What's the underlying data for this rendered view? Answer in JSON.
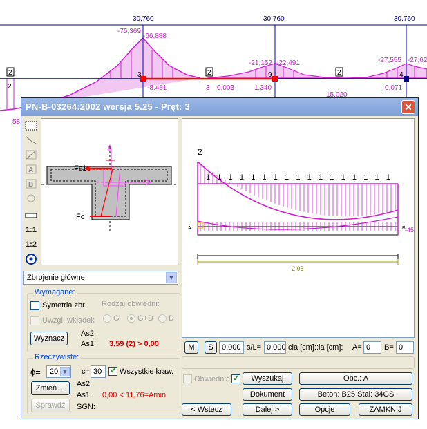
{
  "background": {
    "top_values": [
      "30,760",
      "30,760",
      "30,760"
    ],
    "moment_labels": [
      "-75,369",
      "-66,888",
      "-21,152",
      "-22,491",
      "-27,555",
      "-27,62"
    ],
    "axis_labels": [
      "-8,481",
      "3",
      "0,003",
      "1,340",
      "0,071",
      "15,020",
      "58"
    ],
    "node_numbers": [
      "3",
      "9",
      "4"
    ],
    "span_numbers": [
      "2",
      "2",
      "2",
      "2"
    ],
    "left_span": "2",
    "colors": {
      "moment": "#d020d0",
      "axis": "#000080",
      "support": "#0000cc",
      "selected": "#ff0000"
    }
  },
  "dialog": {
    "title": "PN-B-03264:2002 wersja 5.25 - Pręt: 3",
    "close_icon": "close-icon",
    "toolbar": {
      "items": [
        "grid-icon",
        "line-icon",
        "diagonal-icon",
        "text-a-icon",
        "text-b-icon",
        "refresh-icon",
        "rule-icon",
        "1:1",
        "1:2",
        "target-icon"
      ]
    },
    "section": {
      "fs1": "Fs1",
      "fc": "Fc"
    },
    "select": {
      "value": "Zbrojenie główne"
    },
    "wymagane": {
      "legend": "Wymagane:",
      "symetria": "Symetria zbr.",
      "uwzgl": "Uwzgl. wkładek",
      "rodzaj": "Rodzaj obwiedni:",
      "radios": [
        "G",
        "G+D",
        "D"
      ],
      "wyznacz": "Wyznacz",
      "as2_label": "As2:",
      "as1_label": "As1:",
      "as1_value": "3,59 (2) > 0,00"
    },
    "rzeczywiste": {
      "legend": "Rzeczywiste:",
      "phi_label": "ϕ=",
      "phi_value": "20",
      "c_label": "c=",
      "c_value": "30",
      "wszystkie": "Wszystkie kraw.",
      "zmien": "Zmień ...",
      "sprawdz": "Sprawdź",
      "as2_label": "As2:",
      "as1_label": "As1:",
      "as1_value": "0,00 < 11,76=Amin",
      "sgn_label": "SGN:"
    },
    "diagram": {
      "top_label": "2",
      "rebar_label": "1",
      "rebar_count": 17,
      "end_a": "A",
      "end_b": "B",
      "side_value": "-45",
      "length": "2,95"
    },
    "controls": {
      "m_btn": "M",
      "s_btn": "S",
      "s_value": "0,000",
      "sl_label": "s/L=",
      "sl_value": "0,000",
      "cia_label": "cia [cm]::ia [cm]:",
      "a_label": "A=",
      "a_value": "0",
      "b_label": "B=",
      "b_value": "0"
    },
    "buttons": {
      "obwiednia": "Obwiednia",
      "wyszukaj": "Wyszukaj",
      "obc": "Obc.: A",
      "dokument": "Dokument",
      "beton": "Beton: B25   Stal: 34GS",
      "wstecz": "< Wstecz",
      "dalej": "Dalej >",
      "opcje": "Opcje",
      "zamknij": "ZAMKNIJ"
    }
  }
}
